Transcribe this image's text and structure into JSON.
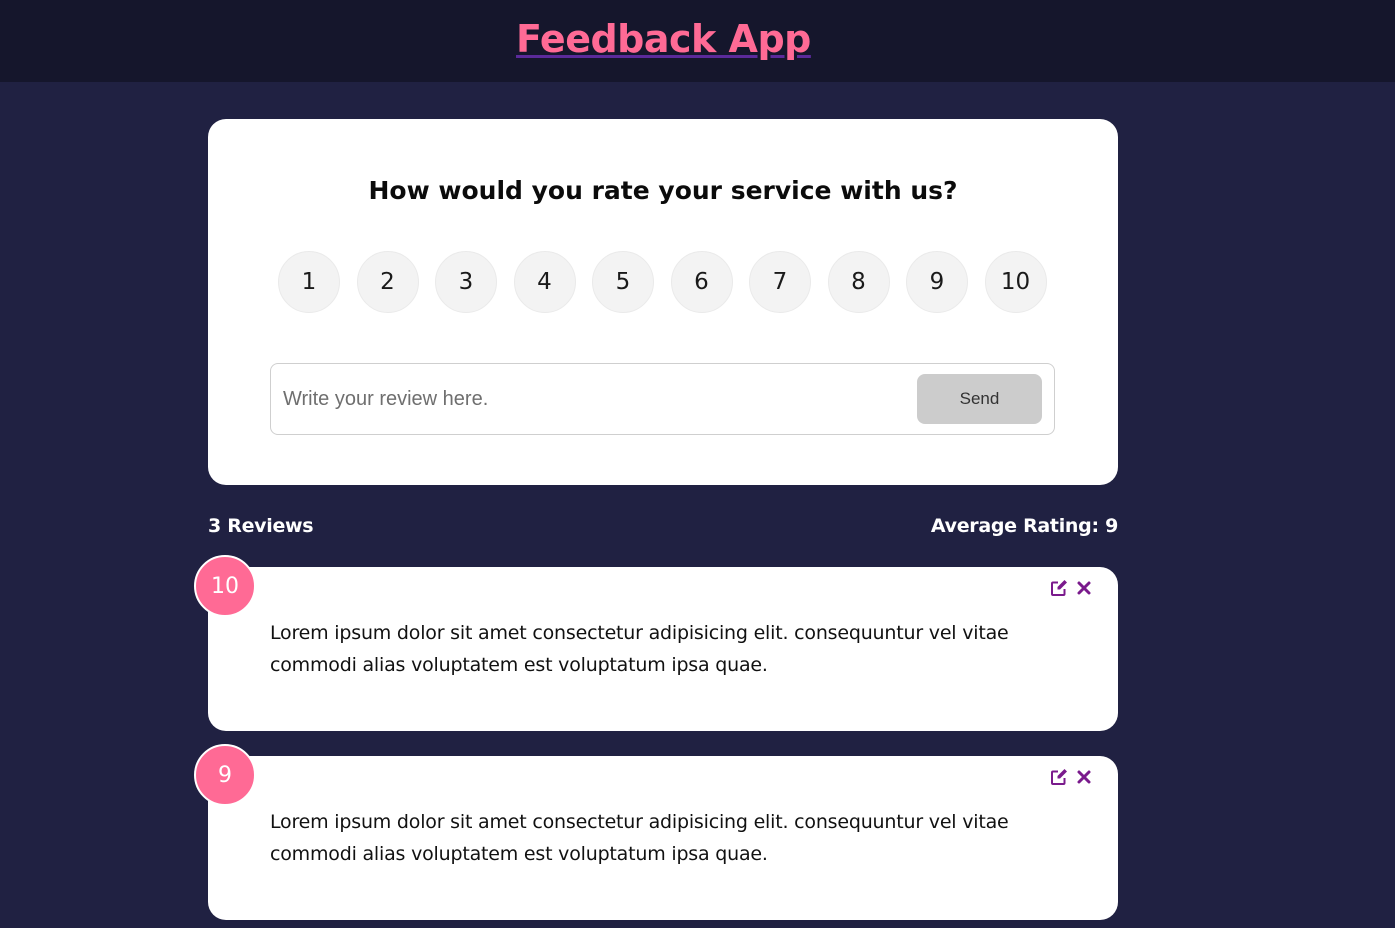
{
  "header": {
    "title": "Feedback App"
  },
  "form": {
    "heading": "How would you rate your service with us?",
    "ratings": [
      "1",
      "2",
      "3",
      "4",
      "5",
      "6",
      "7",
      "8",
      "9",
      "10"
    ],
    "review_placeholder": "Write your review here.",
    "review_value": "",
    "send_label": "Send"
  },
  "stats": {
    "reviews_count": "3 Reviews",
    "average_rating": "Average Rating: 9"
  },
  "reviews": [
    {
      "rating": "10",
      "text": "Lorem ipsum dolor sit amet consectetur adipisicing elit. consequuntur vel vitae commodi alias voluptatem est voluptatum ipsa quae."
    },
    {
      "rating": "9",
      "text": "Lorem ipsum dolor sit amet consectetur adipisicing elit. consequuntur vel vitae commodi alias voluptatem est voluptatum ipsa quae."
    }
  ],
  "icons": {
    "edit": "edit-icon",
    "delete": "close-icon"
  },
  "colors": {
    "background": "#202142",
    "header": "#15162c",
    "accent": "#ff6a95",
    "icon": "#7a1a8c",
    "send_button": "#cccccc"
  }
}
